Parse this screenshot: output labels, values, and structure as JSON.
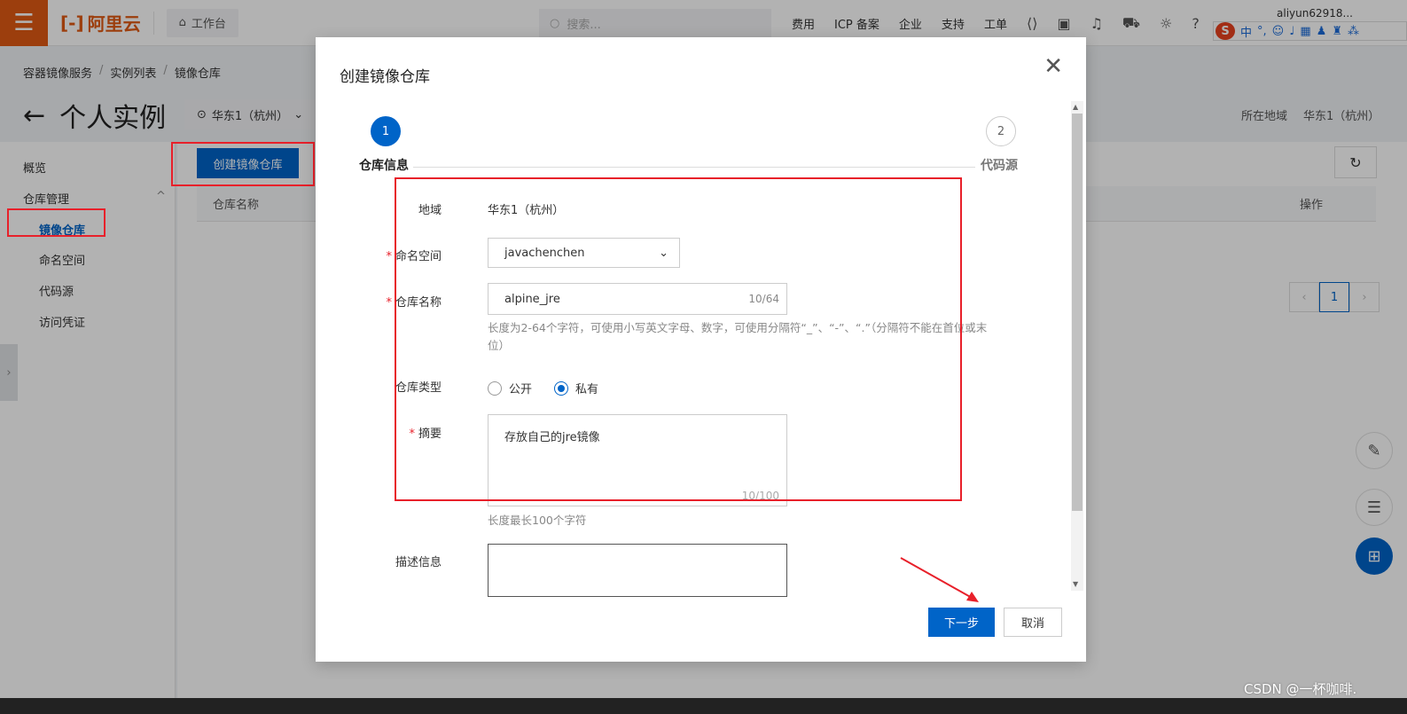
{
  "topbar": {
    "menu_icon": "hamburger-icon",
    "logo": "阿里云",
    "workbench": "工作台",
    "search_placeholder": "搜索...",
    "nav": [
      "费用",
      "ICP 备案",
      "企业",
      "支持",
      "工单"
    ],
    "user": "aliyun62918..."
  },
  "ime": {
    "badge": "S",
    "lang": "中"
  },
  "breadcrumb": [
    "容器镜像服务",
    "实例列表",
    "镜像仓库"
  ],
  "page": {
    "title": "个人实例",
    "region_select": "华东1（杭州）",
    "region_label": "所在地域",
    "region_value": "华东1（杭州）",
    "create_button": "创建镜像仓库",
    "table_col_name": "仓库名称",
    "table_col_ops": "操作",
    "page_number": "1"
  },
  "sidebar": {
    "items": [
      {
        "label": "概览"
      },
      {
        "label": "仓库管理"
      },
      {
        "label": "镜像仓库"
      },
      {
        "label": "命名空间"
      },
      {
        "label": "代码源"
      },
      {
        "label": "访问凭证"
      }
    ]
  },
  "modal": {
    "title": "创建镜像仓库",
    "steps": [
      {
        "num": "1",
        "label": "仓库信息"
      },
      {
        "num": "2",
        "label": "代码源"
      }
    ],
    "fields": {
      "region_label": "地域",
      "region_value": "华东1（杭州）",
      "namespace_label": "命名空间",
      "namespace_value": "javachenchen",
      "repo_name_label": "仓库名称",
      "repo_name_value": "alpine_jre",
      "repo_name_count": "10/64",
      "repo_name_hint": "长度为2-64个字符，可使用小写英文字母、数字，可使用分隔符“_”、“-”、“.”（分隔符不能在首位或末位）",
      "type_label": "仓库类型",
      "type_public": "公开",
      "type_private": "私有",
      "summary_label": "摘要",
      "summary_value": "存放自己的jre镜像",
      "summary_count": "10/100",
      "summary_hint": "长度最长100个字符",
      "desc_label": "描述信息"
    },
    "next_button": "下一步",
    "cancel_button": "取消"
  },
  "watermark": "CSDN @一杯咖啡."
}
